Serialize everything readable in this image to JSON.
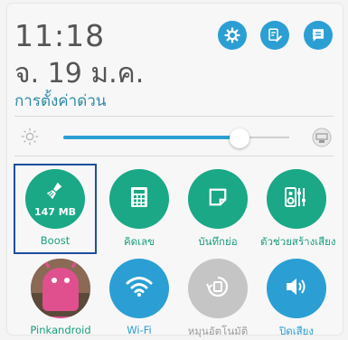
{
  "status": {
    "time": "11:18",
    "date": "จ. 19 ม.ค."
  },
  "quick_settings": {
    "title": "การตั้งค่าด่วน",
    "brightness": {
      "level_fraction": 0.78
    }
  },
  "top_icons": [
    {
      "name": "settings-icon"
    },
    {
      "name": "edit-icon"
    },
    {
      "name": "notes-icon"
    }
  ],
  "tiles_row1": [
    {
      "label": "Boost",
      "value": "147 MB",
      "icon": "broom-icon"
    },
    {
      "label": "คิดเลข",
      "icon": "calculator-icon"
    },
    {
      "label": "บันทึกย่อ",
      "icon": "memo-icon"
    },
    {
      "label": "ตัวช่วยสร้างเสียง",
      "icon": "audio-wizard-icon"
    }
  ],
  "tiles_row2": [
    {
      "label": "Pinkandroid",
      "icon": "avatar-icon"
    },
    {
      "label": "Wi-Fi",
      "icon": "wifi-icon"
    },
    {
      "label": "หมุนอัตโนมัติ",
      "icon": "auto-rotate-icon"
    },
    {
      "label": "ปิดเสียง",
      "icon": "volume-icon"
    }
  ],
  "colors": {
    "accent_blue": "#2b9fd4",
    "tile_green": "#1aa886",
    "tile_disabled": "#c5c5c5",
    "highlight_border": "#1f4fa0"
  }
}
